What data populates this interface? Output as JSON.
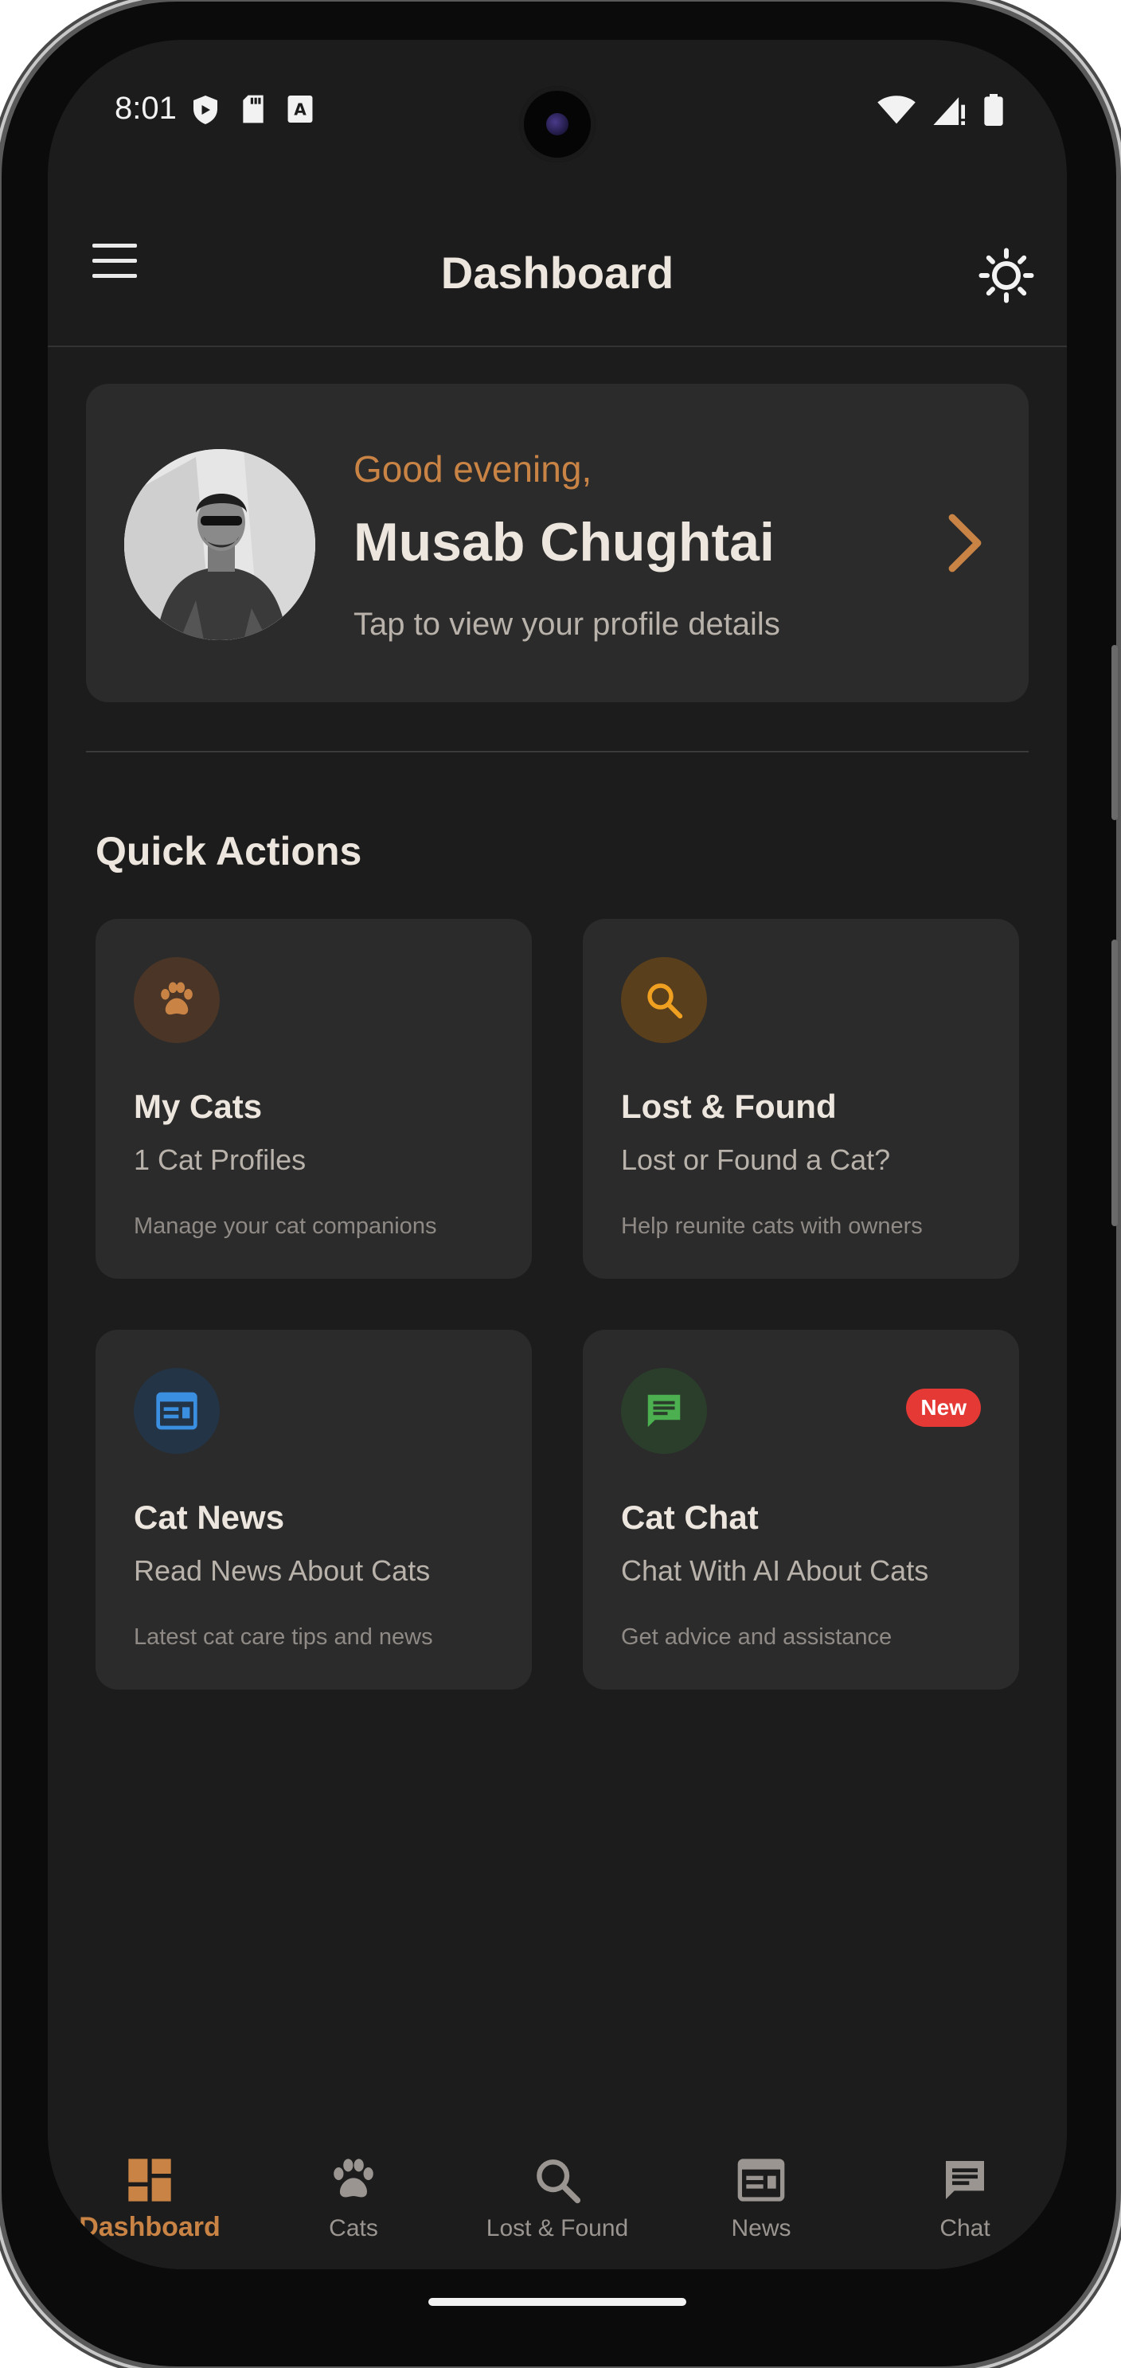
{
  "status": {
    "time": "8:01"
  },
  "app_bar": {
    "title": "Dashboard",
    "menu_icon": "menu-icon",
    "theme_icon": "sun-icon"
  },
  "profile": {
    "greeting": "Good evening,",
    "name": "Musab Chughtai",
    "subtitle": "Tap to view your profile details"
  },
  "quick_actions": {
    "title": "Quick Actions",
    "tiles": [
      {
        "title": "My Cats",
        "subtitle": "1 Cat Profiles",
        "description": "Manage your cat companions",
        "icon": "paw-icon",
        "color": "#c98445"
      },
      {
        "title": "Lost & Found",
        "subtitle": "Lost or Found a Cat?",
        "description": "Help reunite cats with owners",
        "icon": "search-icon",
        "color": "#f0a020"
      },
      {
        "title": "Cat News",
        "subtitle": "Read News About Cats",
        "description": "Latest cat care tips and news",
        "icon": "news-icon",
        "color": "#3a8fe0"
      },
      {
        "title": "Cat Chat",
        "subtitle": "Chat With AI About Cats",
        "description": "Get advice and assistance",
        "icon": "chat-icon",
        "color": "#4caf50",
        "badge": "New"
      }
    ]
  },
  "bottom_nav": {
    "items": [
      {
        "label": "Dashboard",
        "icon": "dashboard-icon",
        "active": true
      },
      {
        "label": "Cats",
        "icon": "paw-icon"
      },
      {
        "label": "Lost & Found",
        "icon": "search-icon"
      },
      {
        "label": "News",
        "icon": "news-icon"
      },
      {
        "label": "Chat",
        "icon": "chat-icon"
      }
    ]
  },
  "colors": {
    "accent": "#c98445",
    "background": "#1c1c1c",
    "card": "#2b2b2b",
    "badge": "#e53935"
  }
}
